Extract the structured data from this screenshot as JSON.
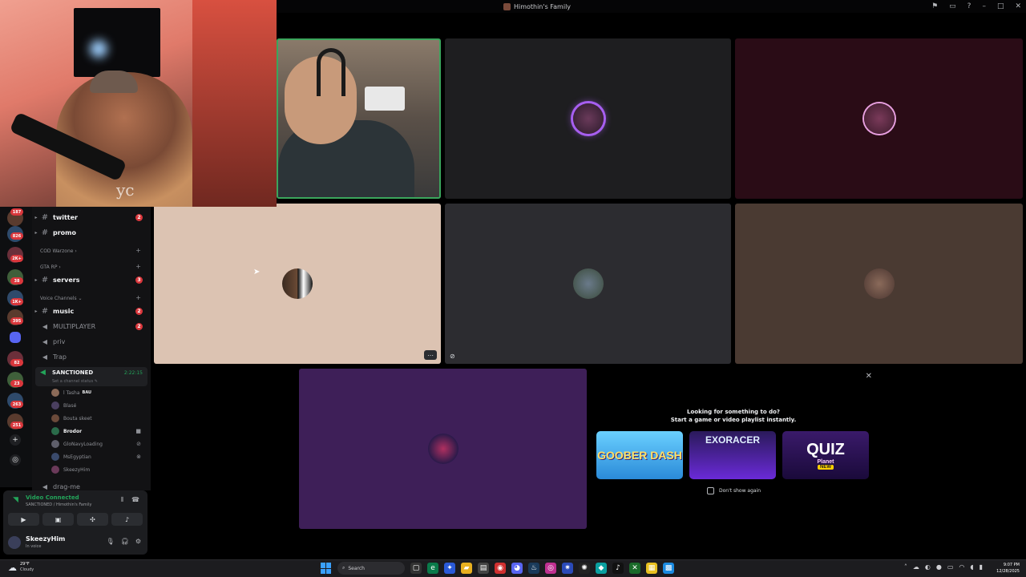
{
  "window": {
    "title": "Himothin's Family",
    "controls": [
      "flag-icon",
      "inbox-icon",
      "help-icon",
      "minimize-icon",
      "maximize-icon",
      "close-icon"
    ]
  },
  "server_rail": {
    "badges": [
      "187",
      "826",
      "2K+",
      "38",
      "1K+",
      "395",
      "82",
      "23",
      "263",
      "251"
    ]
  },
  "channels": {
    "items": [
      {
        "type": "text",
        "label": "twitter",
        "unread": true,
        "count": "2"
      },
      {
        "type": "text",
        "label": "promo",
        "unread": true,
        "count": ""
      }
    ],
    "category_cod": "COD Warzone",
    "category_gta": "GTA RP",
    "servers": {
      "label": "servers",
      "count": "3"
    },
    "category_voice": "Voice Channels",
    "music": {
      "label": "music",
      "count": "2"
    },
    "multiplayer": {
      "label": "MULTIPLAYER",
      "count": "2"
    },
    "priv": "priv",
    "trap": "Trap",
    "active": {
      "name": "SANCTIONED",
      "timer": "2:22:15",
      "status_placeholder": "Set a channel status"
    },
    "voice_users": [
      {
        "name": "l Tasha",
        "tag": "BAU"
      },
      {
        "name": "Blasé"
      },
      {
        "name": "Bouta skeet"
      },
      {
        "name": "Brodor"
      },
      {
        "name": "GloNavyLoading"
      },
      {
        "name": "MsEgyptian"
      },
      {
        "name": "SkeezyHim"
      }
    ],
    "drag_me": "drag-me"
  },
  "voice_panel": {
    "status": "Video Connected",
    "location": "SANCTIONED / Himothin's Family"
  },
  "user_panel": {
    "name": "SkeezyHim",
    "status": "In voice"
  },
  "activity": {
    "prompt_line1": "Looking for something to do?",
    "prompt_line2": "Start a game or video playlist instantly.",
    "games": [
      {
        "title": "GOOBER DASH"
      },
      {
        "title": "EXORACER"
      },
      {
        "title": "QUIZ",
        "subtitle": "Planet",
        "badge": "NEW"
      }
    ],
    "dont_show": "Don't show again"
  },
  "taskbar": {
    "temp": "29°F",
    "condition": "Cloudy",
    "search_label": "Search",
    "time": "9:07 PM",
    "date": "12/28/2025"
  },
  "overlay": {
    "watermark": "yc"
  },
  "colors": {
    "accent_green": "#23a55a",
    "badge_red": "#da373c",
    "speaking_ring": "#a75ff0"
  }
}
